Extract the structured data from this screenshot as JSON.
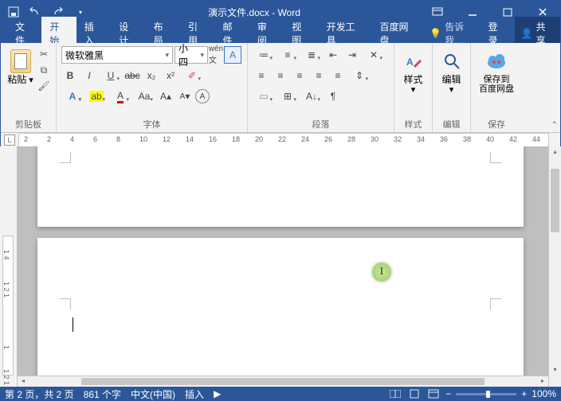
{
  "title": "演示文件.docx - Word",
  "qat": {
    "save": "save",
    "undo": "undo",
    "redo": "redo"
  },
  "tabs": [
    "文件",
    "开始",
    "插入",
    "设计",
    "布局",
    "引用",
    "邮件",
    "审阅",
    "视图",
    "开发工具",
    "百度网盘"
  ],
  "active_tab": "开始",
  "tellme": "告诉我...",
  "login": "登录",
  "share": "共享",
  "groups": {
    "clipboard": {
      "label": "剪贴板",
      "paste": "粘贴"
    },
    "font": {
      "label": "字体",
      "name": "微软雅黑",
      "size": "小四",
      "bold": "B",
      "italic": "I",
      "underline": "U",
      "strike": "abc",
      "sub": "x₂",
      "sup": "x²"
    },
    "para": {
      "label": "段落"
    },
    "styles": {
      "label": "样式",
      "btn": "样式"
    },
    "editing": {
      "label": "编辑",
      "btn": "编辑"
    },
    "baidu": {
      "label": "保存",
      "btn": "保存到\n百度网盘"
    }
  },
  "ruler": {
    "ticks": [
      2,
      2,
      4,
      6,
      8,
      10,
      12,
      14,
      16,
      18,
      20,
      22,
      24,
      26,
      28,
      30,
      32,
      34,
      36,
      38,
      40,
      42,
      44
    ]
  },
  "status": {
    "page": "第 2 页，共 2 页",
    "words": "861 个字",
    "lang": "中文(中国)",
    "mode": "插入",
    "zoom": "100%"
  }
}
